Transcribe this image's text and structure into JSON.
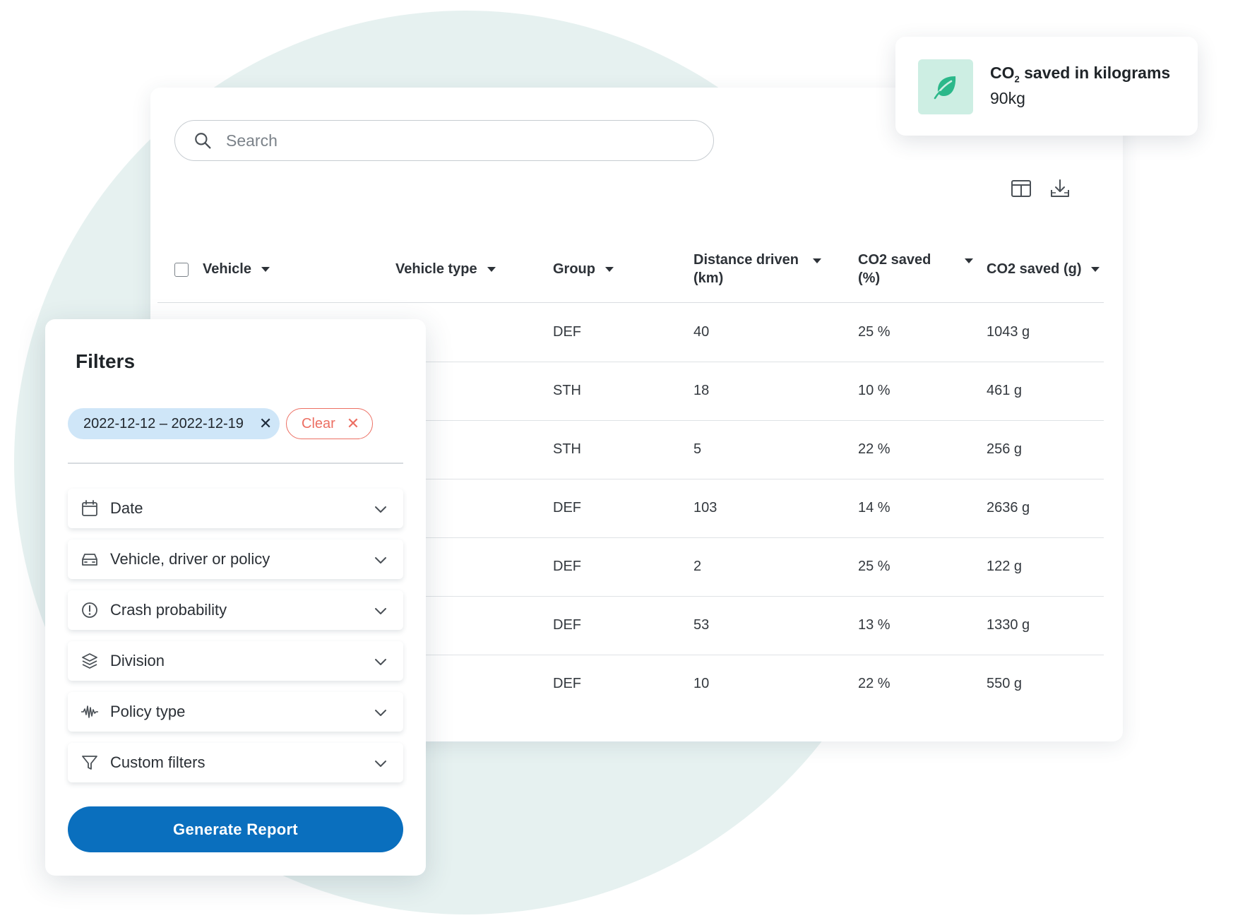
{
  "co2_card": {
    "title_prefix": "CO",
    "title_subscript": "2",
    "title_suffix": " saved in kilograms",
    "value": "90kg",
    "icon": "leaf-icon",
    "accent_color": "#2bb88a"
  },
  "search": {
    "placeholder": "Search"
  },
  "toolbar": {
    "icons": [
      "columns-icon",
      "download-icon"
    ]
  },
  "table": {
    "headers": {
      "vehicle": "Vehicle",
      "vehicle_type": "Vehicle type",
      "group": "Group",
      "distance_line1": "Distance driven",
      "distance_line2": "(km)",
      "co2_pct_line1": "CO2 saved",
      "co2_pct_line2": "(%)",
      "co2_g": "CO2 saved (g)"
    },
    "rows": [
      {
        "group": "DEF",
        "distance": "40",
        "co2_pct": "25 %",
        "co2_g": "1043 g"
      },
      {
        "group": "STH",
        "distance": "18",
        "co2_pct": "10 %",
        "co2_g": "461 g"
      },
      {
        "group": "STH",
        "distance": "5",
        "co2_pct": "22 %",
        "co2_g": "256 g"
      },
      {
        "group": "DEF",
        "distance": "103",
        "co2_pct": "14 %",
        "co2_g": "2636 g"
      },
      {
        "group": "DEF",
        "distance": "2",
        "co2_pct": "25 %",
        "co2_g": "122 g"
      },
      {
        "group": "DEF",
        "distance": "53",
        "co2_pct": "13 %",
        "co2_g": "1330 g"
      },
      {
        "group": "DEF",
        "distance": "10",
        "co2_pct": "22 %",
        "co2_g": "550 g"
      }
    ]
  },
  "filters": {
    "title": "Filters",
    "date_chip": "2022-12-12 – 2022-12-19",
    "clear_chip": "Clear",
    "accordions": [
      {
        "label": "Date",
        "icon": "calendar-icon"
      },
      {
        "label": "Vehicle, driver or policy",
        "icon": "car-icon"
      },
      {
        "label": "Crash probability",
        "icon": "alert-circle-icon"
      },
      {
        "label": "Division",
        "icon": "layers-icon"
      },
      {
        "label": "Policy type",
        "icon": "waveform-icon"
      },
      {
        "label": "Custom filters",
        "icon": "funnel-icon"
      }
    ],
    "generate_button": "Generate Report",
    "button_color": "#0a6fbe",
    "chip_color": "#cfe6f8",
    "clear_color": "#ec6f63"
  }
}
